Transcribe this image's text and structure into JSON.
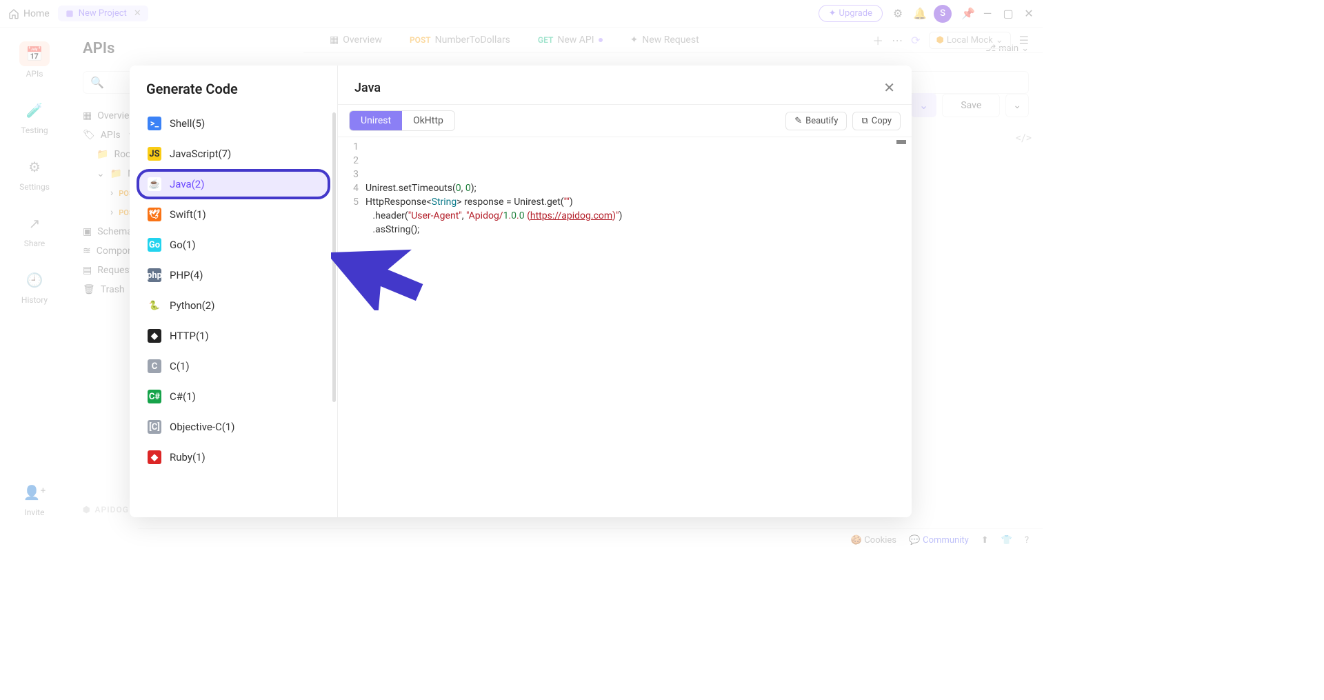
{
  "titlebar": {
    "home": "Home",
    "project_tab": "New Project",
    "upgrade": "Upgrade",
    "avatar_letter": "S"
  },
  "rail": {
    "apis": "APIs",
    "testing": "Testing",
    "settings": "Settings",
    "share": "Share",
    "history": "History",
    "invite": "Invite"
  },
  "header": {
    "title": "APIs",
    "branch": "main"
  },
  "tabs": {
    "overview": "Overview",
    "post_label": "POST",
    "post_name": "NumberToDollars",
    "get_label": "GET",
    "get_name": "New API",
    "new_request": "New Request",
    "local_mock": "Local Mock"
  },
  "tree": {
    "overview": "Overview",
    "apis": "APIs",
    "root": "Root",
    "n": "N",
    "pos1": "POS",
    "pos2": "POS",
    "schemas": "Schema",
    "components": "Compon",
    "requests": "Request",
    "trash": "Trash"
  },
  "save": {
    "label": "Save"
  },
  "brand": {
    "name": "APIDOG"
  },
  "footer": {
    "cookies": "Cookies",
    "community": "Community"
  },
  "modal": {
    "title": "Generate Code",
    "right_title": "Java",
    "lib_tabs": {
      "active": "Unirest",
      "other": "OkHttp"
    },
    "beautify": "Beautify",
    "copy": "Copy",
    "languages": [
      {
        "label": "Shell(5)",
        "icon": ">_",
        "bg": "#3b82f6"
      },
      {
        "label": "JavaScript(7)",
        "icon": "JS",
        "bg": "#facc15"
      },
      {
        "label": "Java(2)",
        "icon": "☕",
        "bg": "#fff",
        "selected": true
      },
      {
        "label": "Swift(1)",
        "icon": "🕊",
        "bg": "#f97316"
      },
      {
        "label": "Go(1)",
        "icon": "Go",
        "bg": "#22d3ee"
      },
      {
        "label": "PHP(4)",
        "icon": "php",
        "bg": "#64748b"
      },
      {
        "label": "Python(2)",
        "icon": "🐍",
        "bg": "#fff"
      },
      {
        "label": "HTTP(1)",
        "icon": "◆",
        "bg": "#222"
      },
      {
        "label": "C(1)",
        "icon": "C",
        "bg": "#9ca3af"
      },
      {
        "label": "C#(1)",
        "icon": "C#",
        "bg": "#16a34a"
      },
      {
        "label": "Objective-C(1)",
        "icon": "[C]",
        "bg": "#9ca3af"
      },
      {
        "label": "Ruby(1)",
        "icon": "◆",
        "bg": "#dc2626"
      }
    ],
    "code_lines": [
      "Unirest.setTimeouts(0, 0);",
      "HttpResponse<String> response = Unirest.get(\"\")",
      "   .header(\"User-Agent\", \"Apidog/1.0.0 (https://apidog.com)\")",
      "   .asString();",
      ""
    ]
  }
}
